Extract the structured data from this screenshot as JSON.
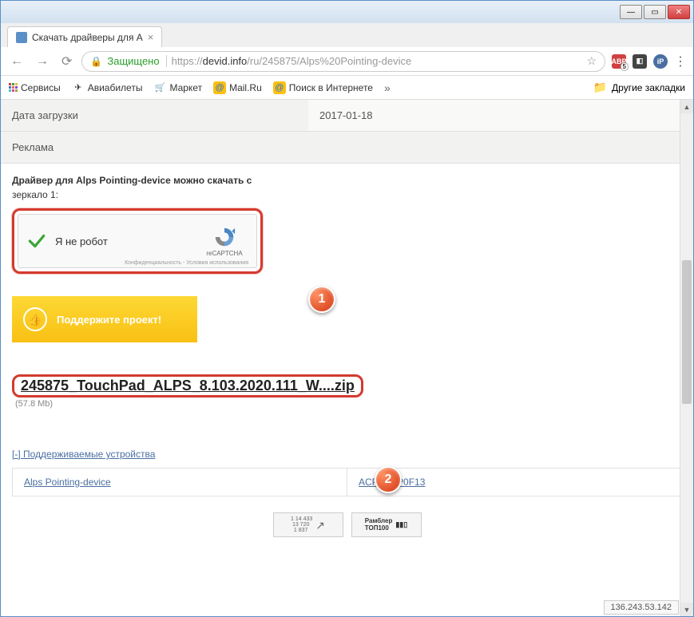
{
  "window": {
    "tab_title": "Скачать драйверы для A"
  },
  "toolbar": {
    "secure_label": "Защищено",
    "url_scheme": "https://",
    "url_host": "devid.info",
    "url_path": "/ru/245875/Alps%20Pointing-device"
  },
  "bookmarks": {
    "services": "Сервисы",
    "avia": "Авиабилеты",
    "market": "Маркет",
    "mailru": "Mail.Ru",
    "search": "Поиск в Интернете",
    "more": "»",
    "other": "Другие закладки"
  },
  "info": {
    "upload_date_label": "Дата загрузки",
    "upload_date_value": "2017-01-18",
    "ad_label": "Реклама"
  },
  "download": {
    "heading": "Драйвер для Alps Pointing-device можно скачать с",
    "mirror": "зеркало 1:",
    "recaptcha_label": "Я не робот",
    "recaptcha_brand": "reCAPTCHA",
    "recaptcha_footer": "Конфиденциальность - Условия использования",
    "support_label": "Поддержите проект!",
    "file_link": "245875_TouchPad_ALPS_8.103.2020.111_W....zip",
    "file_size": "(57.8 Mb)"
  },
  "supported": {
    "title": "[-] Поддерживаемые устройства",
    "device": "Alps Pointing-device",
    "hwid": "ACPI\\PNP0F13"
  },
  "footer": {
    "liveinternet": "1 14 433\n 13 720\n  1 837",
    "rambler": "Рамблер\nТОП100",
    "ip": "136.243.53.142"
  },
  "callouts": {
    "one": "1",
    "two": "2"
  }
}
